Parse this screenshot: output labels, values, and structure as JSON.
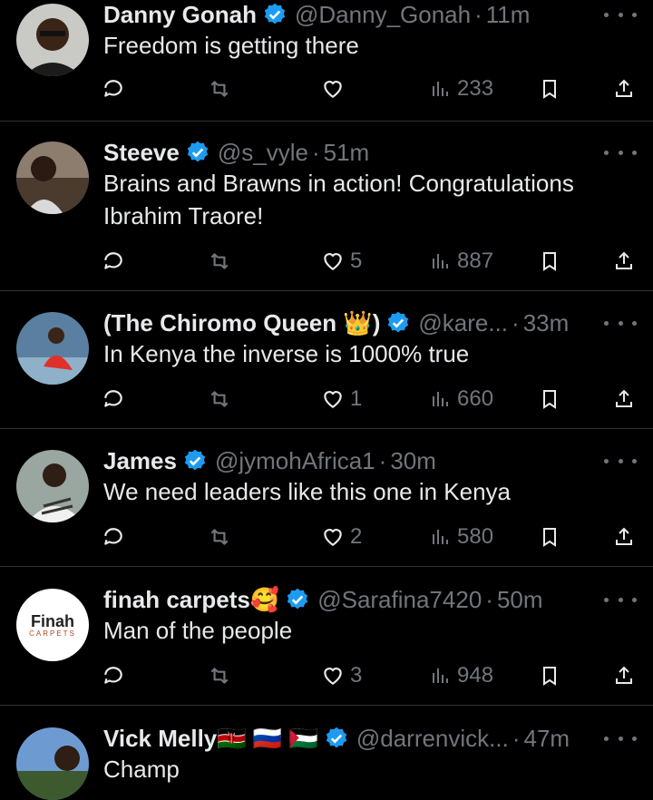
{
  "tweets": [
    {
      "name": "Danny Gonah",
      "handle": "@Danny_Gonah",
      "time": "11m",
      "text": "Freedom is getting there",
      "likes": "",
      "views": "233"
    },
    {
      "name": "Steeve",
      "handle": "@s_vyle",
      "time": "51m",
      "text": "Brains and Brawns in action! Congratulations Ibrahim Traore!",
      "likes": "5",
      "views": "887"
    },
    {
      "name": "(The Chiromo Queen 👑)",
      "handle": "@kare...",
      "time": "33m",
      "text": "In Kenya the inverse is 1000% true",
      "likes": "1",
      "views": "660"
    },
    {
      "name": "James",
      "handle": "@jymohAfrica1",
      "time": "30m",
      "text": "We need leaders like this one in Kenya",
      "likes": "2",
      "views": "580"
    },
    {
      "name": "finah carpets🥰",
      "handle": "@Sarafina7420",
      "time": "50m",
      "text": "Man of the people",
      "likes": "3",
      "views": "948",
      "avatar_text": "Finah",
      "avatar_sub": "CARPETS"
    },
    {
      "name": "Vick Melly🇰🇪 🇷🇺 🇵🇸",
      "handle": "@darrenvick...",
      "time": "47m",
      "text": "Champ",
      "likes": "",
      "views": ""
    }
  ],
  "separator": "·",
  "colors": {
    "background": "#000000",
    "text": "#e7e9ea",
    "muted": "#71767b",
    "verified": "#1d9bf0",
    "divider": "#2f3336"
  },
  "icons": {
    "reply": "reply-icon",
    "retweet": "retweet-icon",
    "like": "heart-icon",
    "views": "views-icon",
    "bookmark": "bookmark-icon",
    "share": "share-icon",
    "more": "more-icon",
    "verified": "verified-badge-icon"
  }
}
